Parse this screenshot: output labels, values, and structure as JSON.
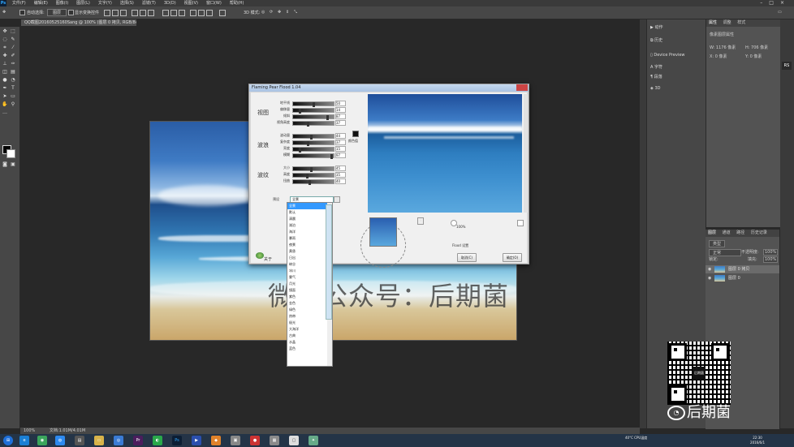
{
  "menu": {
    "app_logo": "Ps",
    "items": [
      "文件(F)",
      "编辑(E)",
      "图像(I)",
      "图层(L)",
      "文字(Y)",
      "选择(S)",
      "滤镜(T)",
      "3D(D)",
      "视图(V)",
      "窗口(W)",
      "帮助(H)"
    ],
    "window_controls": "–□×"
  },
  "options_bar": {
    "auto_select": "自动选择:",
    "auto_select_target": "图层",
    "show_transform": "显示变换控件"
  },
  "document": {
    "tab_title": "QQ截图20160525160Sang @ 100% (图层 0 拷贝, RGB/8#) *",
    "status_zoom": "100%",
    "status_doc": "文档:1.01M/4.01M"
  },
  "watermark": "微信公众号：后期菌",
  "right_panel_a": {
    "items": [
      {
        "icon": "play-icon",
        "label": "动作"
      },
      {
        "icon": "history-icon",
        "label": "历史"
      },
      {
        "icon": "device-icon",
        "label": "Device Preview"
      },
      {
        "icon": "character-icon",
        "label": "字符"
      },
      {
        "icon": "paragraph-icon",
        "label": "段落"
      },
      {
        "icon": "3d-icon",
        "label": "3D"
      }
    ]
  },
  "properties_panel": {
    "tabs": [
      "属性",
      "调整",
      "样式"
    ],
    "title": "像素图层属性",
    "w": "W: 1176 像素",
    "h": "H: 706 像素",
    "x": "X: 0 像素",
    "y": "Y: 0 像素"
  },
  "layers_panel": {
    "tabs": [
      "图层",
      "通道",
      "路径",
      "历史记录"
    ],
    "kind": "类型",
    "blend": "正常",
    "opacity_label": "不透明度:",
    "opacity": "100%",
    "lock_label": "锁定:",
    "fill_label": "填充:",
    "fill": "100%",
    "layers": [
      "图层 0 拷贝",
      "图层 0"
    ]
  },
  "dialog": {
    "title": "Flaming Pear Flood 1.04",
    "groups": [
      "视图",
      "波浪",
      "波纹"
    ],
    "view_sliders": [
      {
        "label": "地平线",
        "value": "50",
        "pos": 0.5
      },
      {
        "label": "偏移量",
        "value": "14",
        "pos": 0.14
      },
      {
        "label": "倾斜",
        "value": "87",
        "pos": 0.87
      },
      {
        "label": "视角高度",
        "value": "37",
        "pos": 0.37
      }
    ],
    "wave_sliders": [
      {
        "label": "波动量",
        "value": "44",
        "pos": 0.44
      },
      {
        "label": "复杂度",
        "value": "37",
        "pos": 0.37
      },
      {
        "label": "亮度",
        "value": "15",
        "pos": 0.15
      },
      {
        "label": "模糊",
        "value": "97",
        "pos": 0.97
      }
    ],
    "ripple_sliders": [
      {
        "label": "大小",
        "value": "45",
        "pos": 0.45
      },
      {
        "label": "高度",
        "value": "35",
        "pos": 0.35
      },
      {
        "label": "扭曲",
        "value": "40",
        "pos": 0.4
      }
    ],
    "color_label": "颜色值",
    "preset_label": "预设",
    "preset_value": "全景",
    "zoom": "100%",
    "credit": "Flood 设置",
    "about": "关于",
    "cancel": "取消(C)",
    "ok": "确定(O)",
    "list_items": [
      "全景",
      "默认",
      "清晨",
      "湖泊",
      "海洋",
      "暴雨",
      "夜景",
      "黄昏",
      "日出",
      "峡谷",
      "冰川",
      "雾气",
      "月光",
      "镜面",
      "紫色",
      "金色",
      "绿色",
      "热带",
      "极光",
      "大海洋",
      "古典",
      "水晶",
      "蓝色"
    ]
  },
  "brand": {
    "name": "后期菌",
    "qr_center": "后期菌"
  },
  "taskbar": {
    "cpu": "40°C CPU温度",
    "time": "22:30",
    "date": "2016/6/1"
  }
}
